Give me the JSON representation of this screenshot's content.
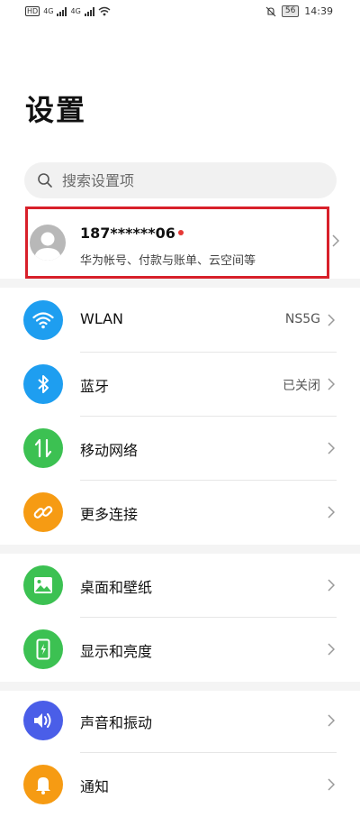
{
  "status_bar": {
    "hd_label": "HD",
    "net1": "4G",
    "net2": "4G",
    "battery": "56",
    "time": "14:39"
  },
  "page": {
    "title": "设置"
  },
  "search": {
    "placeholder": "搜索设置项"
  },
  "account": {
    "name": "187******06",
    "subtitle": "华为帐号、付款与账单、云空间等"
  },
  "groups": [
    [
      {
        "label": "WLAN",
        "value": "NS5G",
        "icon": "wifi-icon",
        "color": "#1e9ef0"
      },
      {
        "label": "蓝牙",
        "value": "已关闭",
        "icon": "bluetooth-icon",
        "color": "#1e9ef0"
      },
      {
        "label": "移动网络",
        "value": "",
        "icon": "mobile-data-icon",
        "color": "#3cc152"
      },
      {
        "label": "更多连接",
        "value": "",
        "icon": "link-icon",
        "color": "#f69b13"
      }
    ],
    [
      {
        "label": "桌面和壁纸",
        "value": "",
        "icon": "wallpaper-icon",
        "color": "#3cc152"
      },
      {
        "label": "显示和亮度",
        "value": "",
        "icon": "display-icon",
        "color": "#3cc152"
      }
    ],
    [
      {
        "label": "声音和振动",
        "value": "",
        "icon": "sound-icon",
        "color": "#4a5ee8"
      },
      {
        "label": "通知",
        "value": "",
        "icon": "notification-icon",
        "color": "#f69b13"
      }
    ]
  ]
}
